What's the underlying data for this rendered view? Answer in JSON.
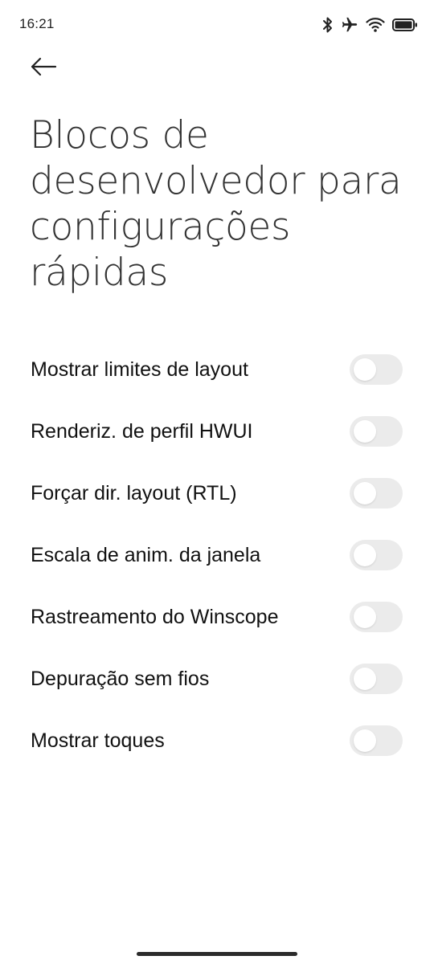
{
  "status_bar": {
    "time": "16:21",
    "icons": [
      "bluetooth-icon",
      "airplane-icon",
      "wifi-icon",
      "battery-icon"
    ]
  },
  "header": {
    "back_icon": "arrow-left-icon"
  },
  "page": {
    "title": "Blocos de desenvolvedor para configurações rápidas"
  },
  "settings": [
    {
      "label": "Mostrar limites de layout",
      "enabled": false
    },
    {
      "label": "Renderiz. de perfil HWUI",
      "enabled": false
    },
    {
      "label": "Forçar dir. layout (RTL)",
      "enabled": false
    },
    {
      "label": "Escala de anim. da janela",
      "enabled": false
    },
    {
      "label": "Rastreamento do Winscope",
      "enabled": false
    },
    {
      "label": "Depuração sem fios",
      "enabled": false
    },
    {
      "label": "Mostrar toques",
      "enabled": false
    }
  ],
  "colors": {
    "background": "#ffffff",
    "title_text": "#333333",
    "label_text": "#111111",
    "toggle_off_track": "#ebebeb",
    "toggle_knob": "#ffffff"
  }
}
